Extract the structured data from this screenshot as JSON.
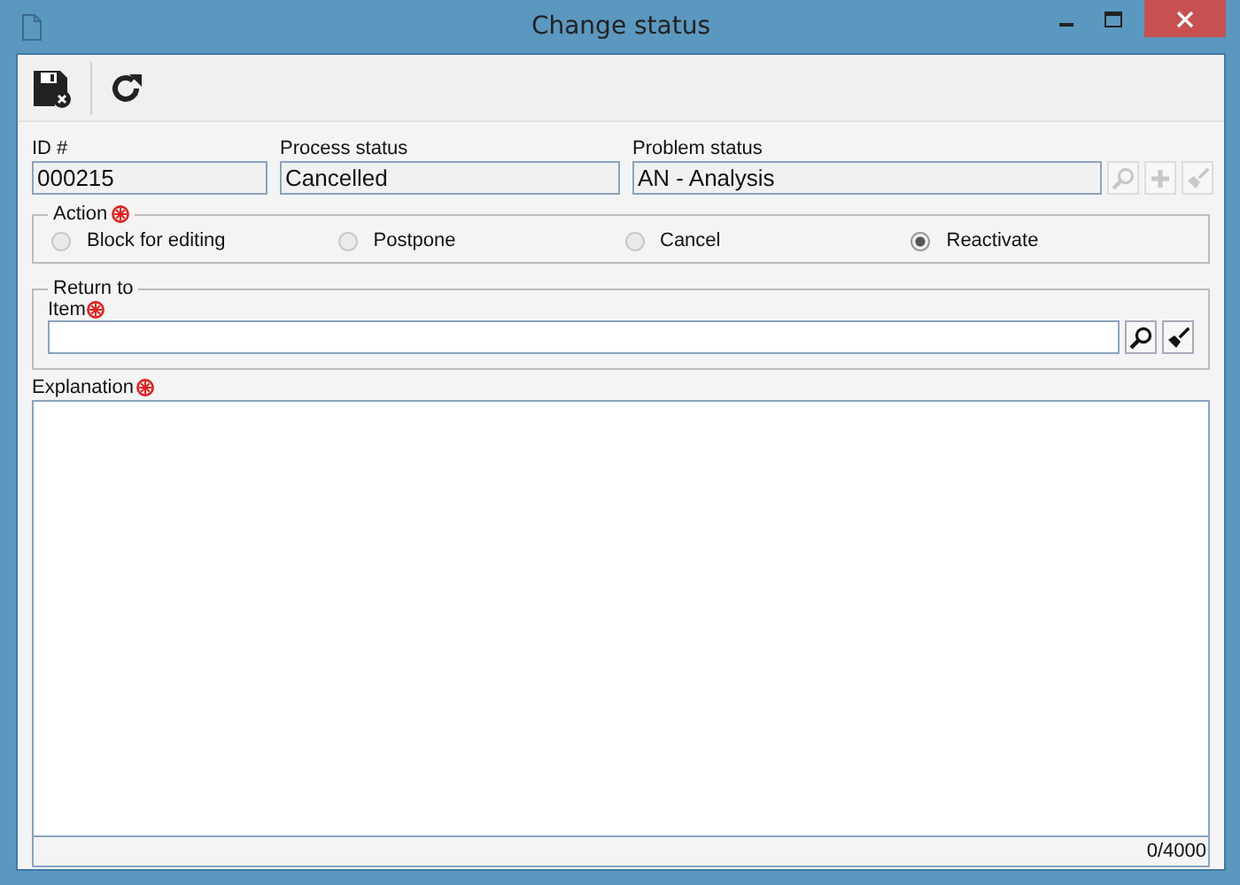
{
  "window": {
    "title": "Change status"
  },
  "toolbar": [
    {
      "kind": "save-cancel"
    },
    {
      "kind": "refresh"
    }
  ],
  "fields": [
    {
      "label": "ID #",
      "value": "000215"
    },
    {
      "label": "Process status",
      "value": "Cancelled"
    },
    {
      "label": "Problem status",
      "value": "AN - Analysis",
      "buttons": [
        {
          "kind": "search",
          "disabled": true
        },
        {
          "kind": "add",
          "disabled": true
        },
        {
          "kind": "clear",
          "disabled": true
        }
      ]
    }
  ],
  "action": {
    "legend": "Action",
    "required": true,
    "options": [
      {
        "label": "Block for editing",
        "selected": false
      },
      {
        "label": "Postpone",
        "selected": false
      },
      {
        "label": "Cancel",
        "selected": false
      },
      {
        "label": "Reactivate",
        "selected": true
      }
    ]
  },
  "return_to": {
    "legend": "Return to",
    "item": {
      "label": "Item",
      "required": true,
      "buttons": [
        {
          "kind": "search",
          "disabled": false
        },
        {
          "kind": "clear",
          "disabled": false
        }
      ]
    }
  },
  "explanation": {
    "label": "Explanation",
    "required": true,
    "counter": "0/4000"
  }
}
